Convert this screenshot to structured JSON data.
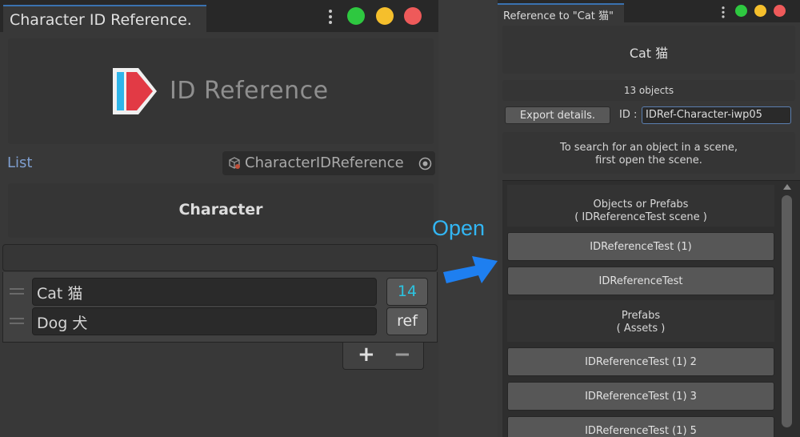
{
  "left_window": {
    "tab_title": "Character ID Reference.",
    "logo_text": "ID Reference",
    "list_label": "List",
    "object_field_value": "CharacterIDReference",
    "category_title": "Character",
    "rows": [
      {
        "name": "Cat 猫",
        "button": "14"
      },
      {
        "name": "Dog 犬",
        "button": "ref"
      }
    ],
    "add_label": "+",
    "remove_label": "−"
  },
  "open_label": "Open",
  "right_window": {
    "tab_title": "Reference to \"Cat 猫\"",
    "header_title": "Cat 猫",
    "object_count": "13 objects",
    "export_label": "Export details.",
    "id_label": "ID :",
    "id_value": "IDRef-Character-iwp05",
    "hint_line1": "To search for an object in a scene,",
    "hint_line2": "first open the scene.",
    "sections": [
      {
        "title": "Objects or Prefabs",
        "subtitle": "( IDReferenceTest scene )"
      },
      {
        "title": "Prefabs",
        "subtitle": "( Assets )"
      }
    ],
    "items": [
      "IDReferenceTest (1)",
      "IDReferenceTest",
      "IDReferenceTest (1) 2",
      "IDReferenceTest (1) 3",
      "IDReferenceTest (1) 5"
    ]
  },
  "colors": {
    "close": "#ee5a5a",
    "minimize": "#f5bf2c",
    "maximize": "#2ec840",
    "accent_open": "#32b6f4",
    "count_text": "#2cc3e0",
    "logo_red": "#e23a45",
    "logo_blue": "#2fb5ea"
  }
}
